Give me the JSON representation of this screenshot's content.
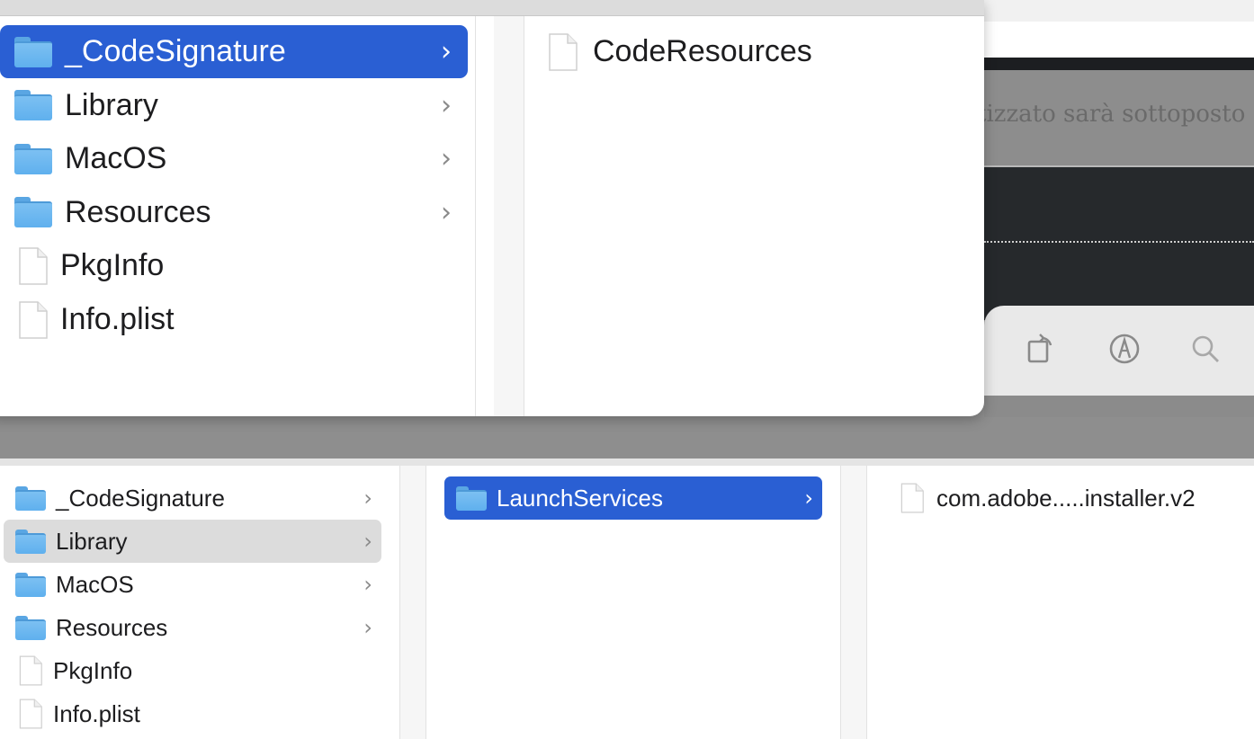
{
  "background_app": {
    "italian_text": "tizzato sarà sottoposto",
    "toolbar_icons": [
      "rotate-icon",
      "markup-icon",
      "search-icon"
    ]
  },
  "top_window": {
    "column1": [
      {
        "label": "_CodeSignature",
        "kind": "folder",
        "has_children": true,
        "selected": true
      },
      {
        "label": "Library",
        "kind": "folder",
        "has_children": true,
        "selected": false
      },
      {
        "label": "MacOS",
        "kind": "folder",
        "has_children": true,
        "selected": false
      },
      {
        "label": "Resources",
        "kind": "folder",
        "has_children": true,
        "selected": false
      },
      {
        "label": "PkgInfo",
        "kind": "file",
        "has_children": false,
        "selected": false
      },
      {
        "label": "Info.plist",
        "kind": "file",
        "has_children": false,
        "selected": false
      }
    ],
    "column2": [
      {
        "label": "CodeResources",
        "kind": "file"
      }
    ]
  },
  "bottom_window": {
    "column1": [
      {
        "label": "_CodeSignature",
        "kind": "folder",
        "has_children": true
      },
      {
        "label": "Library",
        "kind": "folder",
        "has_children": true,
        "highlighted": true
      },
      {
        "label": "MacOS",
        "kind": "folder",
        "has_children": true
      },
      {
        "label": "Resources",
        "kind": "folder",
        "has_children": true
      },
      {
        "label": "PkgInfo",
        "kind": "file",
        "has_children": false
      },
      {
        "label": "Info.plist",
        "kind": "file",
        "has_children": false
      }
    ],
    "column2": [
      {
        "label": "LaunchServices",
        "kind": "folder",
        "has_children": true,
        "selected": true
      }
    ],
    "column3": [
      {
        "label": "com.adobe.....installer.v2",
        "kind": "file"
      }
    ]
  },
  "chevron_glyph": "›",
  "colors": {
    "selection": "#2a5fd3",
    "inactive_selection": "#dcdcdc",
    "folder": "#6cb6ef"
  }
}
